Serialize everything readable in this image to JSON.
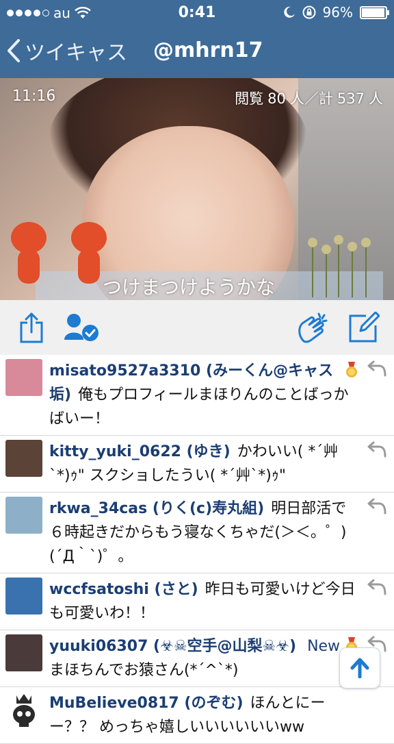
{
  "status_bar": {
    "carrier": "au",
    "time": "0:41",
    "battery": "96%",
    "battery_level": 0.96
  },
  "nav": {
    "back_label": "ツイキャス",
    "title": "@mhrn17"
  },
  "video": {
    "elapsed": "11:16",
    "views_label": "閲覧",
    "views_current": "80",
    "views_unit": "人／計",
    "views_total": "537",
    "views_total_unit": "人",
    "caption": "つけまつけようかな"
  },
  "toolbar": {
    "icons": [
      "share-icon",
      "follow-user-icon",
      "clap-icon",
      "compose-icon"
    ]
  },
  "comments": [
    {
      "username": "misato9527a3310",
      "display": "(みーくん@キャス垢)",
      "text": "俺もプロフィールまほりんのことばっかばいー！",
      "medal": true,
      "avatar_color": "#d98a9a"
    },
    {
      "username": "kitty_yuki_0622",
      "display": "(ゆき)",
      "text": "かわいい( *´艸`*)ｩ\" スクショしたうい( *´艸`*)ｩ\"",
      "medal": false,
      "avatar_color": "#5c4338"
    },
    {
      "username": "rkwa_34cas",
      "display": "(りく(c)寿丸組)",
      "text": "明日部活で６時起きだからもう寝なくちゃだ(＞＜。゜)(´Д｀`)゜。",
      "medal": false,
      "avatar_color": "#8db0c8"
    },
    {
      "username": "wccfsatoshi",
      "display": "(さと)",
      "text": "昨日も可愛いけど今日も可愛いわ！！",
      "medal": false,
      "avatar_color": "#3a72b0"
    },
    {
      "username": "yuuki06307",
      "display": "(☣☠空手@山梨☠☣)",
      "text": "まほちんでお猿さん(*´^`*)",
      "badge": "New",
      "medal": true,
      "avatar_color": "#4a3a3a"
    },
    {
      "username": "MuBelieve0817",
      "display": "(のぞむ)",
      "text": "ほんとにーー？？ めっちゃ嬉しいいいいいいww",
      "medal": false,
      "avatar_color": "#2b2b2b"
    }
  ],
  "colors": {
    "nav_bg": "#3e6b98",
    "accent": "#1d7bd1",
    "username": "#1b3e73"
  }
}
